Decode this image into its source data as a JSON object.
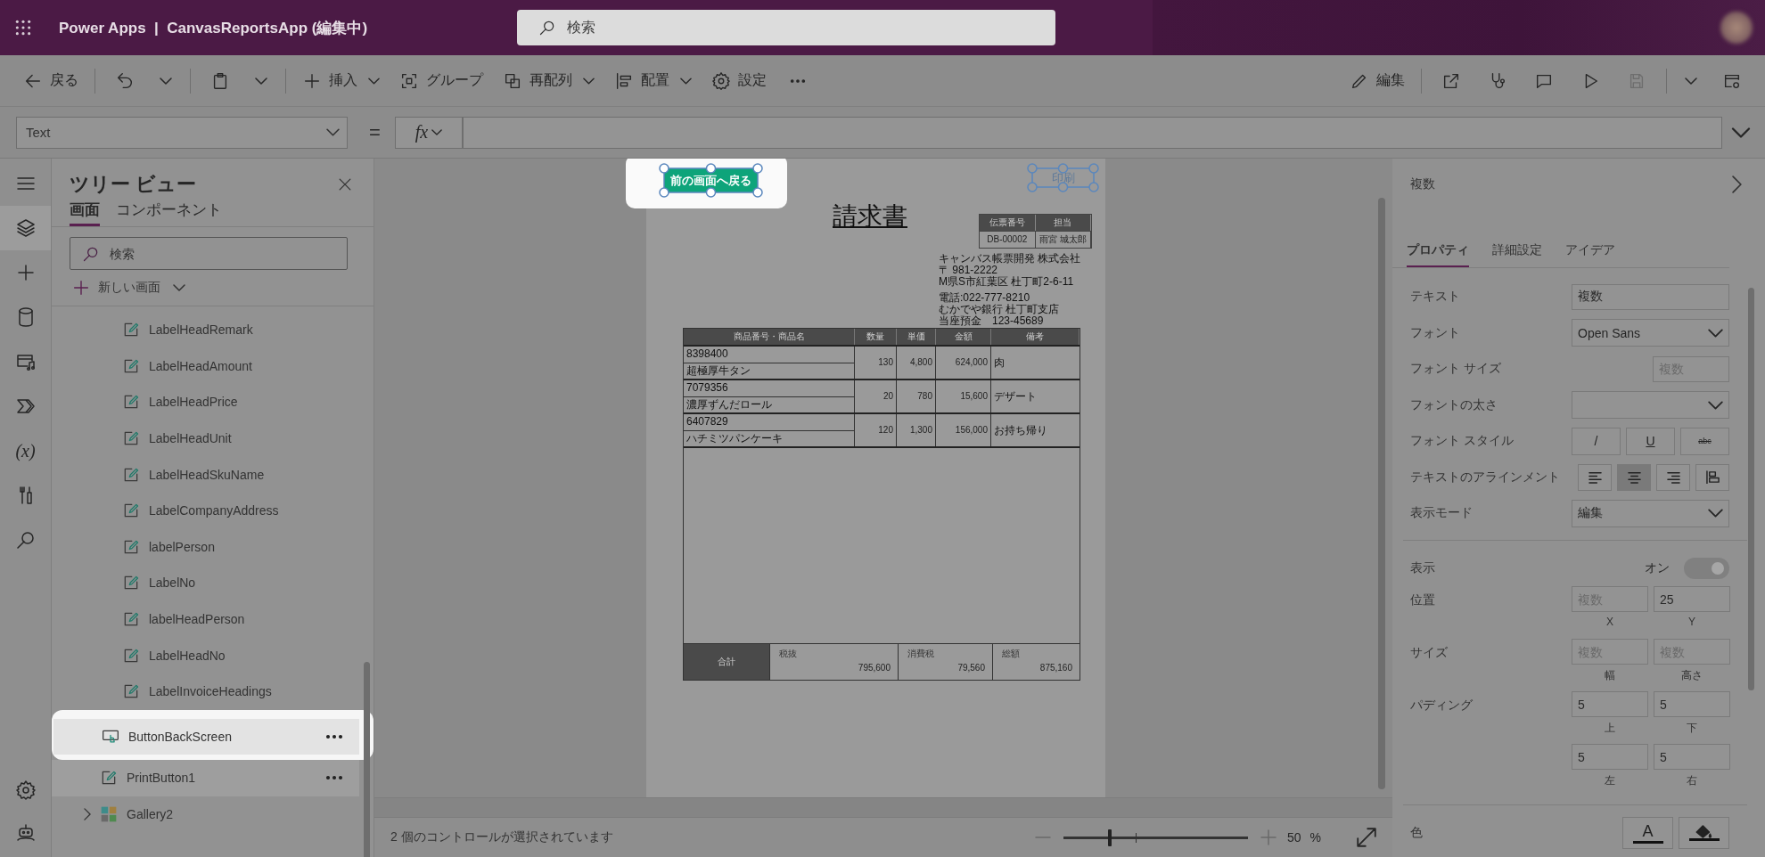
{
  "app_bar": {
    "title": "Power Apps  |  CanvasReportsApp (編集中)",
    "search": {
      "placeholder": "検索"
    }
  },
  "toolbar": {
    "left": [
      {
        "kind": "back",
        "label": "戻る"
      },
      {
        "kind": "separator"
      },
      {
        "kind": "undo"
      },
      {
        "kind": "dropdown"
      },
      {
        "kind": "separator"
      },
      {
        "kind": "paste"
      },
      {
        "kind": "dropdown"
      },
      {
        "kind": "separator"
      },
      {
        "kind": "insert",
        "label": "挿入",
        "menu": true
      },
      {
        "kind": "group",
        "label": "グループ"
      },
      {
        "kind": "reorder",
        "label": "再配列",
        "menu": true
      },
      {
        "kind": "align",
        "label": "配置",
        "menu": true
      },
      {
        "kind": "settings",
        "label": "設定"
      },
      {
        "kind": "more"
      }
    ],
    "right": [
      {
        "kind": "edit",
        "label": "編集"
      },
      {
        "kind": "separator"
      },
      {
        "kind": "share"
      },
      {
        "kind": "health"
      },
      {
        "kind": "comment"
      },
      {
        "kind": "play"
      },
      {
        "kind": "save"
      },
      {
        "kind": "separator"
      },
      {
        "kind": "dropdown"
      },
      {
        "kind": "checker"
      }
    ]
  },
  "formula_bar": {
    "property": "Text",
    "operator": "=",
    "fx": "fx"
  },
  "rail": [
    {
      "kind": "menu",
      "selected": false
    },
    {
      "kind": "layers",
      "selected": true
    },
    {
      "kind": "insert",
      "selected": false
    },
    {
      "kind": "data",
      "selected": false
    },
    {
      "kind": "media",
      "selected": false
    },
    {
      "kind": "automate",
      "selected": false
    },
    {
      "kind": "variables",
      "glyph": "(x)",
      "selected": false
    },
    {
      "kind": "tools",
      "selected": false
    },
    {
      "kind": "search",
      "selected": false
    },
    {
      "kind": "spacer"
    },
    {
      "kind": "settings",
      "selected": false
    },
    {
      "kind": "bot",
      "selected": false
    }
  ],
  "tree": {
    "title": "ツリー ビュー",
    "tabs": [
      {
        "label": "画面",
        "selected": true
      },
      {
        "label": "コンポーネント",
        "selected": false
      }
    ],
    "search": {
      "placeholder": "検索"
    },
    "new_screen": "新しい画面",
    "items": [
      {
        "kind": "group",
        "children": [
          {
            "kind": "label",
            "name": "LabelHeadRemark",
            "selected": false,
            "highlighted": false
          },
          {
            "kind": "label",
            "name": "LabelHeadAmount",
            "selected": false,
            "highlighted": false
          },
          {
            "kind": "label",
            "name": "LabelHeadPrice",
            "selected": false,
            "highlighted": false
          },
          {
            "kind": "label",
            "name": "LabelHeadUnit",
            "selected": false,
            "highlighted": false
          },
          {
            "kind": "label",
            "name": "LabelHeadSkuName",
            "selected": false,
            "highlighted": false
          },
          {
            "kind": "label",
            "name": "LabelCompanyAddress",
            "selected": false,
            "highlighted": false
          },
          {
            "kind": "label",
            "name": "labelPerson",
            "selected": false,
            "highlighted": false
          },
          {
            "kind": "label",
            "name": "LabelNo",
            "selected": false,
            "highlighted": false
          },
          {
            "kind": "label",
            "name": "labelHeadPerson",
            "selected": false,
            "highlighted": false
          },
          {
            "kind": "label",
            "name": "LabelHeadNo",
            "selected": false,
            "highlighted": false
          },
          {
            "kind": "label",
            "name": "LabelInvoiceHeadings",
            "selected": false,
            "highlighted": false
          }
        ]
      },
      {
        "kind": "button",
        "name": "ButtonBackScreen",
        "selected": true,
        "highlighted": true
      },
      {
        "kind": "label",
        "name": "PrintButton1",
        "selected": true,
        "highlighted": false
      },
      {
        "kind": "gallery",
        "name": "Gallery2",
        "selected": false,
        "highlighted": false,
        "expanded": false
      }
    ]
  },
  "page": {
    "back_button": {
      "label": "前の画面へ戻る",
      "selected": true,
      "highlighted": true
    },
    "print_button": {
      "label": "印刷",
      "selected": true,
      "highlighted": false
    },
    "title": "請求書",
    "slip": {
      "columns": [
        "伝票番号",
        "担当"
      ],
      "values": [
        "DB-00002",
        "雨宮 城太郎"
      ]
    },
    "address": [
      [
        "キャンバス帳票開発 株式会社",
        "〒 981-2222",
        "M県S市紅葉区 杜丁町2-6-11"
      ],
      [
        "電話:022-777-8210",
        "むかでや銀行 杜丁町支店",
        "当座預金　123-45689"
      ]
    ],
    "table": {
      "columns": [
        "商品番号・商品名",
        "数量",
        "単価",
        "金額",
        "備考"
      ],
      "rows": [
        {
          "sku": "8398400",
          "name": "超極厚牛タン",
          "qty": "130",
          "price": "4,800",
          "amount": "624,000",
          "note": "肉"
        },
        {
          "sku": "7079356",
          "name": "濃厚ずんだロール",
          "qty": "20",
          "price": "780",
          "amount": "15,600",
          "note": "デザート"
        },
        {
          "sku": "6407829",
          "name": "ハチミツパンケーキ",
          "qty": "120",
          "price": "1,300",
          "amount": "156,000",
          "note": "お持ち帰り"
        }
      ]
    },
    "totals": {
      "label": "合計",
      "cells": [
        {
          "label": "税抜",
          "value": "795,600"
        },
        {
          "label": "消費税",
          "value": "79,560"
        },
        {
          "label": "総額",
          "value": "875,160"
        }
      ]
    }
  },
  "status_bar": {
    "text": "2 個のコントロールが選択されています",
    "zoom": {
      "level": 0.25,
      "value": "50",
      "unit": "%"
    }
  },
  "properties": {
    "selection": "複数",
    "tabs": [
      {
        "label": "プロパティ",
        "selected": true
      },
      {
        "label": "詳細設定",
        "selected": false
      },
      {
        "label": "アイデア",
        "selected": false
      }
    ],
    "rows": [
      {
        "kind": "text",
        "label": "テキスト",
        "value": "複数"
      },
      {
        "kind": "dropdown",
        "label": "フォント",
        "value": "Open Sans"
      },
      {
        "kind": "number",
        "label": "フォント サイズ",
        "placeholder": "複数"
      },
      {
        "kind": "dropdown",
        "label": "フォントの太さ"
      },
      {
        "kind": "styles",
        "label": "フォント スタイル",
        "options": [
          {
            "kind": "italic",
            "label": "/"
          },
          {
            "kind": "underline",
            "label": "U"
          },
          {
            "kind": "strike",
            "label": "abc"
          }
        ]
      },
      {
        "kind": "align",
        "label": "テキストのアラインメント",
        "options": [
          {
            "kind": "left",
            "selected": false
          },
          {
            "kind": "center",
            "selected": true
          },
          {
            "kind": "right",
            "selected": false
          },
          {
            "kind": "top",
            "selected": false
          }
        ]
      },
      {
        "kind": "dropdown",
        "label": "表示モード",
        "value": "編集"
      },
      {
        "kind": "divider"
      },
      {
        "kind": "toggle",
        "label": "表示",
        "state_text": "オン",
        "on": true
      },
      {
        "kind": "pair",
        "label": "位置",
        "fields": [
          {
            "placeholder": "複数",
            "caption": "X"
          },
          {
            "value": "25",
            "caption": "Y"
          }
        ]
      },
      {
        "kind": "pair",
        "label": "サイズ",
        "fields": [
          {
            "placeholder": "複数",
            "caption": "幅"
          },
          {
            "placeholder": "複数",
            "caption": "高さ"
          }
        ]
      },
      {
        "kind": "pair",
        "label": "パディング",
        "fields": [
          {
            "value": "5",
            "caption": "上"
          },
          {
            "value": "5",
            "caption": "下"
          }
        ]
      },
      {
        "kind": "pair",
        "fields": [
          {
            "value": "5",
            "caption": "左"
          },
          {
            "value": "5",
            "caption": "右"
          }
        ]
      },
      {
        "kind": "divider"
      },
      {
        "kind": "colors",
        "label": "色",
        "buttons": [
          {
            "kind": "font",
            "label": "A"
          },
          {
            "kind": "fill"
          }
        ]
      }
    ]
  }
}
